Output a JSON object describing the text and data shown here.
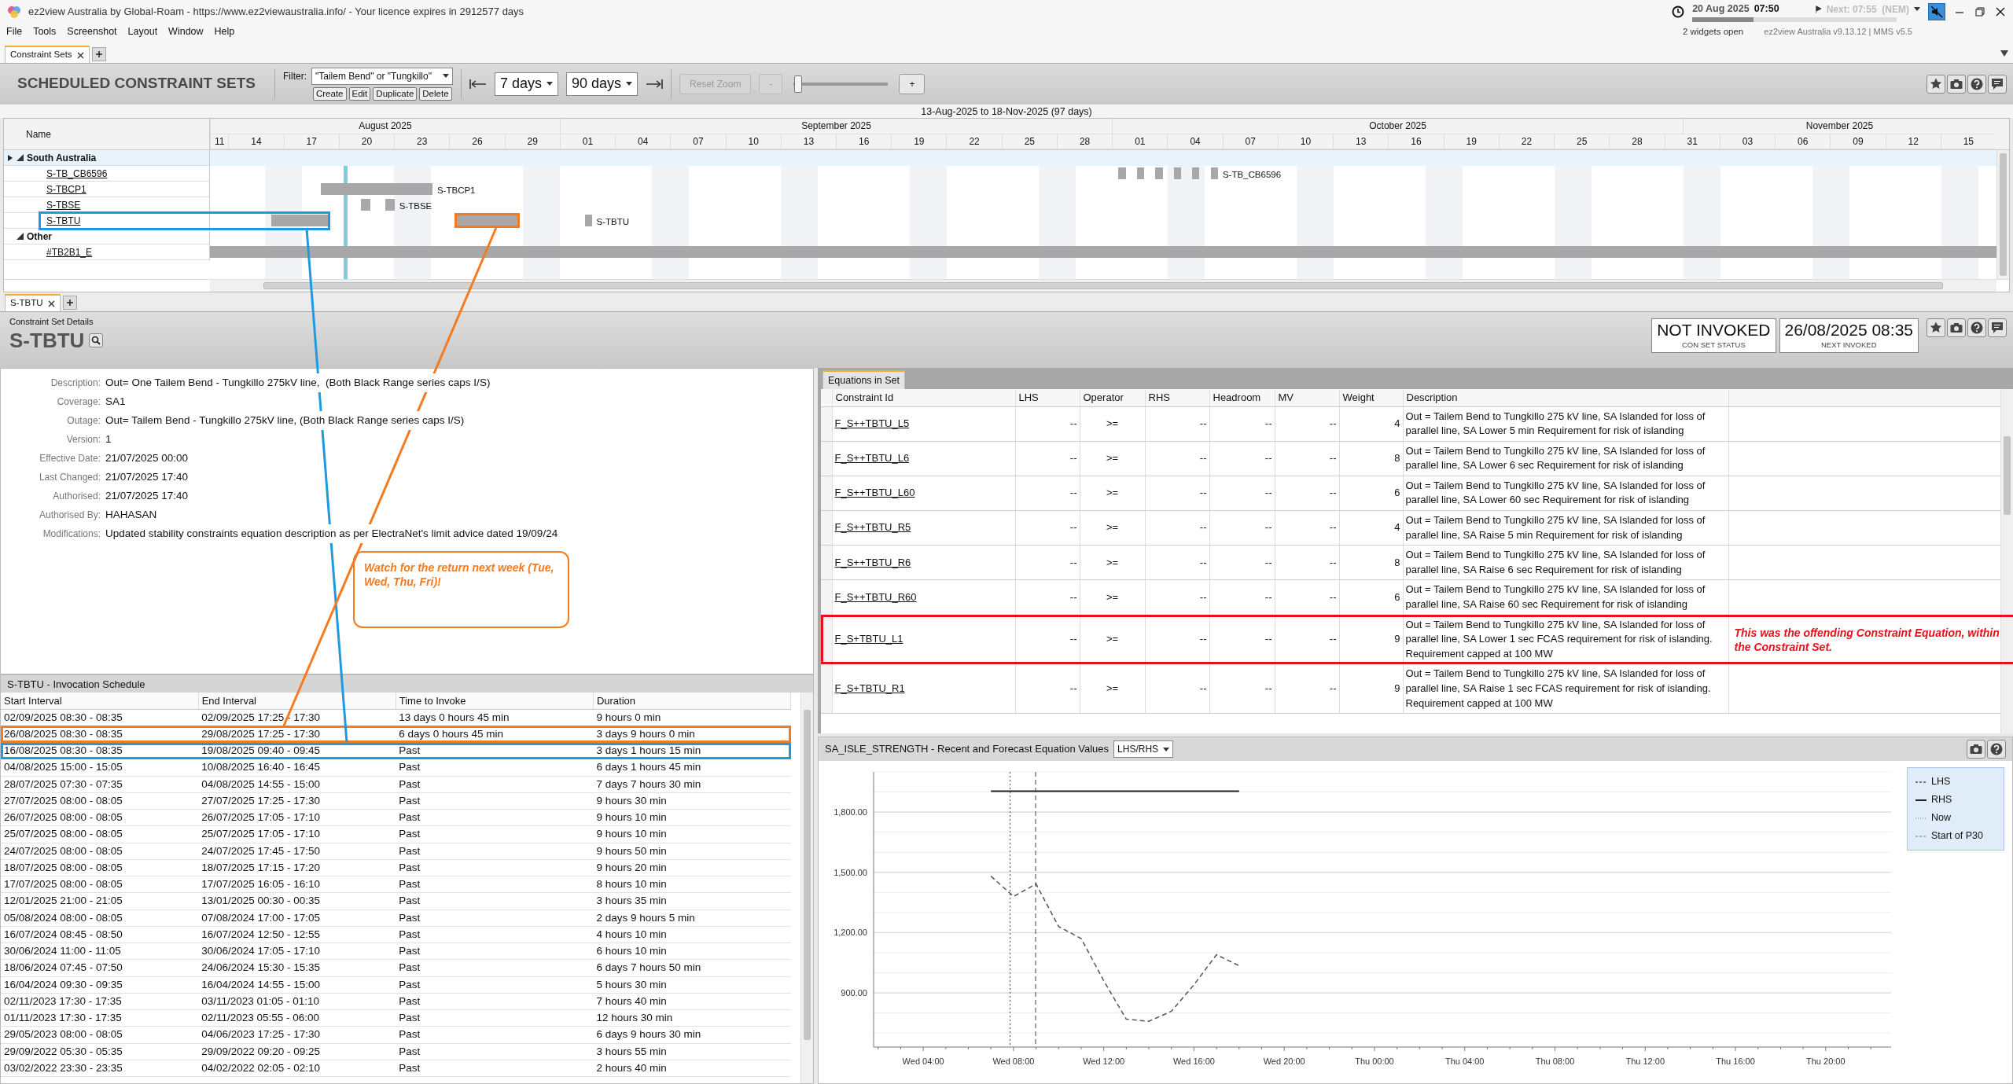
{
  "window": {
    "title": "ez2view Australia by Global-Roam - https://www.ez2viewaustralia.info/ - Your licence expires in 2912577 days",
    "date": "20 Aug 2025",
    "time": "07:50",
    "next": "Next: 07:55  (NEM)",
    "progress": {
      "level": 0.3
    },
    "muted": true
  },
  "menu": [
    "File",
    "Tools",
    "Screenshot",
    "Layout",
    "Window",
    "Help"
  ],
  "status": {
    "widgets": "2 widgets open",
    "version": "ez2view Australia v9.13.12 | MMS v5.5"
  },
  "top_tabs": [
    {
      "label": "Constraint Sets",
      "selected": true
    }
  ],
  "toolbar": {
    "title": "SCHEDULED CONSTRAINT SETS",
    "filter_label": "Filter:",
    "filter_value": "\"Tailem Bend\" or \"Tungkillo\"",
    "buttons": [
      "Create",
      "Edit",
      "Duplicate",
      "Delete"
    ],
    "back_range": "7 days",
    "forward_range": "90 days",
    "reset_zoom": {
      "label": "Reset Zoom",
      "disabled": true
    },
    "zoom_out": {
      "label": "-",
      "disabled": true
    },
    "zoom_in": {
      "label": "+",
      "disabled": false
    },
    "zoom": {
      "level": 0.05
    }
  },
  "gantt": {
    "range_label": "13-Aug-2025 to 18-Nov-2025 (97 days)",
    "name_header": "Name",
    "months": [
      "August 2025",
      "September 2025",
      "October 2025",
      "November 2025"
    ],
    "ticks": [
      "11",
      "14",
      "17",
      "20",
      "23",
      "26",
      "29",
      "01",
      "04",
      "07",
      "10",
      "13",
      "16",
      "19",
      "22",
      "25",
      "28",
      "01",
      "04",
      "07",
      "10",
      "13",
      "16",
      "19",
      "22",
      "25",
      "28",
      "31",
      "03",
      "06",
      "09",
      "12",
      "15"
    ],
    "rows": [
      {
        "kind": "group",
        "label": "South Australia",
        "expanded": true,
        "selected": true
      },
      {
        "kind": "item",
        "label": "S-TB_CB6596",
        "selected": false,
        "bar_label": "S-TB_CB6596",
        "bars": [
          {
            "kind": "bar"
          },
          {
            "kind": "bar"
          },
          {
            "kind": "bar"
          },
          {
            "kind": "bar"
          },
          {
            "kind": "bar"
          },
          {
            "kind": "bar"
          }
        ]
      },
      {
        "kind": "item",
        "label": "S-TBCP1",
        "selected": false,
        "bar_label": "S-TBCP1",
        "bars": [
          {
            "kind": "bar"
          }
        ]
      },
      {
        "kind": "item",
        "label": "S-TBSE",
        "selected": false,
        "bar_label": "S-TBSE",
        "bars": [
          {
            "kind": "bar"
          },
          {
            "kind": "bar"
          }
        ]
      },
      {
        "kind": "item",
        "label": "S-TBTU",
        "selected": false,
        "color": "#1e9be0",
        "bar_label": "S-TBTU",
        "bars": [
          {
            "kind": "bar"
          },
          {
            "kind": "bar",
            "color": "#f47b20"
          },
          {
            "kind": "bar"
          }
        ]
      },
      {
        "kind": "group",
        "label": "Other",
        "expanded": true,
        "selected": false
      },
      {
        "kind": "item",
        "label": "#TB2B1_E",
        "selected": false,
        "bars": [
          {
            "kind": "bar"
          }
        ]
      }
    ]
  },
  "bottom_tabs": [
    {
      "label": "S-TBTU",
      "selected": true
    }
  ],
  "details": {
    "caption": "Constraint Set Details",
    "name": "S-TBTU",
    "statuses": [
      {
        "value": "NOT INVOKED",
        "caption": "CON SET STATUS"
      },
      {
        "value": "26/08/2025 08:35",
        "caption": "NEXT INVOKED"
      }
    ],
    "fields": [
      {
        "label": "Description:",
        "value": "Out= One Tailem Bend - Tungkillo 275kV line,  (Both Black Range series caps I/S)"
      },
      {
        "label": "Coverage:",
        "value": "SA1"
      },
      {
        "label": "Outage:",
        "value": "Out= Tailem Bend - Tungkillo 275kV line, (Both Black Range series caps I/S)"
      },
      {
        "label": "Version:",
        "value": "1"
      },
      {
        "label": "Effective Date:",
        "value": "21/07/2025 00:00"
      },
      {
        "label": "Last Changed:",
        "value": "21/07/2025 17:40"
      },
      {
        "label": "Authorised:",
        "value": "21/07/2025 17:40"
      },
      {
        "label": "Authorised By:",
        "value": "HAHASAN"
      },
      {
        "label": "Modifications:",
        "value": "Updated stability constraints equation description as per ElectraNet's limit advice dated 19/09/24"
      }
    ]
  },
  "annotations": {
    "callout": {
      "text": "Watch for the return next week (Tue, Wed, Thu, Fri)!",
      "color": "#f47b20"
    },
    "connectors": [
      {
        "color": "#1e9be0"
      },
      {
        "color": "#f47b20"
      }
    ]
  },
  "invocations": {
    "title": "S-TBTU - Invocation Schedule",
    "columns": [
      "Start Interval",
      "End Interval",
      "Time to Invoke",
      "Duration"
    ],
    "rows": [
      {
        "cells": [
          "02/09/2025 08:30 - 08:35",
          "02/09/2025 17:25 - 17:30",
          "13 days 0 hours 45 min",
          "9 hours 0 min"
        ]
      },
      {
        "cells": [
          "26/08/2025 08:30 - 08:35",
          "29/08/2025 17:25 - 17:30",
          "6 days 0 hours 45 min",
          "3 days 9 hours 0 min"
        ],
        "color": "#f47b20"
      },
      {
        "cells": [
          "16/08/2025 08:30 - 08:35",
          "19/08/2025 09:40 - 09:45",
          "Past",
          "3 days 1 hours 15 min"
        ],
        "color": "#1e9be0"
      },
      {
        "cells": [
          "04/08/2025 15:00 - 15:05",
          "10/08/2025 16:40 - 16:45",
          "Past",
          "6 days 1 hours 45 min"
        ]
      },
      {
        "cells": [
          "28/07/2025 07:30 - 07:35",
          "04/08/2025 14:55 - 15:00",
          "Past",
          "7 days 7 hours 30 min"
        ]
      },
      {
        "cells": [
          "27/07/2025 08:00 - 08:05",
          "27/07/2025 17:25 - 17:30",
          "Past",
          "9 hours 30 min"
        ]
      },
      {
        "cells": [
          "26/07/2025 08:00 - 08:05",
          "26/07/2025 17:05 - 17:10",
          "Past",
          "9 hours 10 min"
        ]
      },
      {
        "cells": [
          "25/07/2025 08:00 - 08:05",
          "25/07/2025 17:05 - 17:10",
          "Past",
          "9 hours 10 min"
        ]
      },
      {
        "cells": [
          "24/07/2025 08:00 - 08:05",
          "24/07/2025 17:45 - 17:50",
          "Past",
          "9 hours 50 min"
        ]
      },
      {
        "cells": [
          "18/07/2025 08:00 - 08:05",
          "18/07/2025 17:15 - 17:20",
          "Past",
          "9 hours 20 min"
        ]
      },
      {
        "cells": [
          "17/07/2025 08:00 - 08:05",
          "17/07/2025 16:05 - 16:10",
          "Past",
          "8 hours 10 min"
        ]
      },
      {
        "cells": [
          "12/01/2025 21:00 - 21:05",
          "13/01/2025 00:30 - 00:35",
          "Past",
          "3 hours 35 min"
        ]
      },
      {
        "cells": [
          "05/08/2024 08:00 - 08:05",
          "07/08/2024 17:00 - 17:05",
          "Past",
          "2 days 9 hours 5 min"
        ]
      },
      {
        "cells": [
          "16/07/2024 08:45 - 08:50",
          "16/07/2024 12:50 - 12:55",
          "Past",
          "4 hours 10 min"
        ]
      },
      {
        "cells": [
          "30/06/2024 11:00 - 11:05",
          "30/06/2024 17:05 - 17:10",
          "Past",
          "6 hours 10 min"
        ]
      },
      {
        "cells": [
          "18/06/2024 07:45 - 07:50",
          "24/06/2024 15:30 - 15:35",
          "Past",
          "6 days 7 hours 50 min"
        ]
      },
      {
        "cells": [
          "16/04/2024 09:30 - 09:35",
          "16/04/2024 14:55 - 15:00",
          "Past",
          "5 hours 30 min"
        ]
      },
      {
        "cells": [
          "02/11/2023 17:30 - 17:35",
          "03/11/2023 01:05 - 01:10",
          "Past",
          "7 hours 40 min"
        ]
      },
      {
        "cells": [
          "01/11/2023 17:30 - 17:35",
          "02/11/2023 05:55 - 06:00",
          "Past",
          "12 hours 30 min"
        ]
      },
      {
        "cells": [
          "29/05/2023 08:00 - 08:05",
          "04/06/2023 17:25 - 17:30",
          "Past",
          "6 days 9 hours 30 min"
        ]
      },
      {
        "cells": [
          "29/09/2022 05:30 - 05:35",
          "29/09/2022 09:20 - 09:25",
          "Past",
          "3 hours 55 min"
        ]
      },
      {
        "cells": [
          "03/02/2022 23:30 - 23:35",
          "04/02/2022 02:05 - 02:10",
          "Past",
          "2 hours 40 min"
        ]
      }
    ]
  },
  "equations": {
    "tabs": [
      {
        "label": "Equations in Set",
        "selected": true
      }
    ],
    "columns": [
      "Constraint Id",
      "LHS",
      "Operator",
      "RHS",
      "Headroom",
      "MV",
      "Weight",
      "Description"
    ],
    "rows": [
      {
        "id": "F_S++TBTU_L5",
        "lhs": "--",
        "operator": ">=",
        "rhs": "--",
        "headroom": "--",
        "mv": "--",
        "weight": "4",
        "description": "Out = Tailem Bend to Tungkillo 275 kV line, SA Islanded for loss of parallel line, SA Lower 5 min Requirement for risk of islanding"
      },
      {
        "id": "F_S++TBTU_L6",
        "lhs": "--",
        "operator": ">=",
        "rhs": "--",
        "headroom": "--",
        "mv": "--",
        "weight": "8",
        "description": "Out = Tailem Bend to Tungkillo 275 kV line, SA Islanded for loss of parallel line, SA Lower 6 sec Requirement for risk of islanding"
      },
      {
        "id": "F_S++TBTU_L60",
        "lhs": "--",
        "operator": ">=",
        "rhs": "--",
        "headroom": "--",
        "mv": "--",
        "weight": "6",
        "description": "Out = Tailem Bend to Tungkillo 275 kV line, SA Islanded for loss of parallel line, SA Lower 60 sec Requirement for risk of islanding"
      },
      {
        "id": "F_S++TBTU_R5",
        "lhs": "--",
        "operator": ">=",
        "rhs": "--",
        "headroom": "--",
        "mv": "--",
        "weight": "4",
        "description": "Out = Tailem Bend to Tungkillo 275 kV line, SA Islanded for loss of parallel line, SA Raise 5 min Requirement for risk of islanding"
      },
      {
        "id": "F_S++TBTU_R6",
        "lhs": "--",
        "operator": ">=",
        "rhs": "--",
        "headroom": "--",
        "mv": "--",
        "weight": "8",
        "description": "Out = Tailem Bend to Tungkillo 275 kV line, SA Islanded for loss of parallel line, SA Raise 6 sec Requirement for risk of islanding"
      },
      {
        "id": "F_S++TBTU_R60",
        "lhs": "--",
        "operator": ">=",
        "rhs": "--",
        "headroom": "--",
        "mv": "--",
        "weight": "6",
        "description": "Out = Tailem Bend to Tungkillo 275 kV line, SA Islanded for loss of parallel line, SA Raise 60 sec Requirement for risk of islanding"
      },
      {
        "id": "F_S+TBTU_L1",
        "lhs": "--",
        "operator": ">=",
        "rhs": "--",
        "headroom": "--",
        "mv": "--",
        "weight": "9",
        "description": "Out = Tailem Bend to Tungkillo 275 kV line, SA Islanded for loss of parallel line, SA Lower 1 sec FCAS requirement for risk of islanding. Requirement capped at 100 MW",
        "note": "This was the offending Constraint Equation, within the Constraint Set.",
        "color": "#e8101a"
      },
      {
        "id": "F_S+TBTU_R1",
        "lhs": "--",
        "operator": ">=",
        "rhs": "--",
        "headroom": "--",
        "mv": "--",
        "weight": "9",
        "description": "Out = Tailem Bend to Tungkillo 275 kV line, SA Islanded for loss of parallel line, SA Raise 1 sec FCAS requirement for risk of islanding. Requirement capped at 100 MW"
      }
    ]
  },
  "chart_panel": {
    "title": "SA_ISLE_STRENGTH - Recent and Forecast Equation Values",
    "mode": "LHS/RHS",
    "markers": [
      {
        "label": "Now"
      },
      {
        "label": "Start of P30"
      }
    ],
    "chart_data": {
      "type": "line",
      "grid": true,
      "categories": [
        null,
        null,
        "Wed 04:00",
        null,
        null,
        null,
        "Wed 08:00",
        null,
        null,
        null,
        "Wed 12:00",
        null,
        null,
        null,
        "Wed 16:00",
        null,
        null,
        null,
        "Wed 20:00",
        null,
        null,
        null,
        "Thu 00:00",
        null,
        null,
        null,
        "Thu 04:00",
        null,
        null,
        null,
        "Thu 08:00",
        null,
        null,
        null,
        "Thu 12:00",
        null,
        null,
        null,
        "Thu 16:00",
        null,
        null,
        null,
        "Thu 20:00",
        null,
        null
      ],
      "series": [
        {
          "name": "LHS",
          "color": "#555555",
          "line_style": "dashed",
          "values": [
            null,
            null,
            null,
            null,
            null,
            1481,
            1380,
            1442,
            1230,
            1170,
            960,
            769,
            758,
            808,
            940,
            1090,
            1035,
            null,
            null,
            null,
            null,
            null,
            null,
            null,
            null,
            null,
            null,
            null,
            null,
            null,
            null,
            null,
            null,
            null,
            null,
            null,
            null,
            null,
            null,
            null,
            null,
            null,
            null,
            null,
            null
          ]
        },
        {
          "name": "RHS",
          "color": "#222222",
          "line_style": "solid",
          "values": [
            null,
            null,
            null,
            null,
            null,
            1904,
            1904,
            1904,
            1904,
            1904,
            1904,
            1904,
            1904,
            1904,
            1904,
            1904,
            1904,
            null,
            null,
            null,
            null,
            null,
            null,
            null,
            null,
            null,
            null,
            null,
            null,
            null,
            null,
            null,
            null,
            null,
            null,
            null,
            null,
            null,
            null,
            null,
            null,
            null,
            null,
            null,
            null
          ]
        }
      ],
      "ylim": [
        630,
        2000
      ],
      "yticks": [
        {
          "value": 900,
          "label": "900.00"
        },
        {
          "value": 1200,
          "label": "1,200.00"
        },
        {
          "value": 1500,
          "label": "1,500.00"
        },
        {
          "value": 1800,
          "label": "1,800.00"
        }
      ]
    }
  }
}
